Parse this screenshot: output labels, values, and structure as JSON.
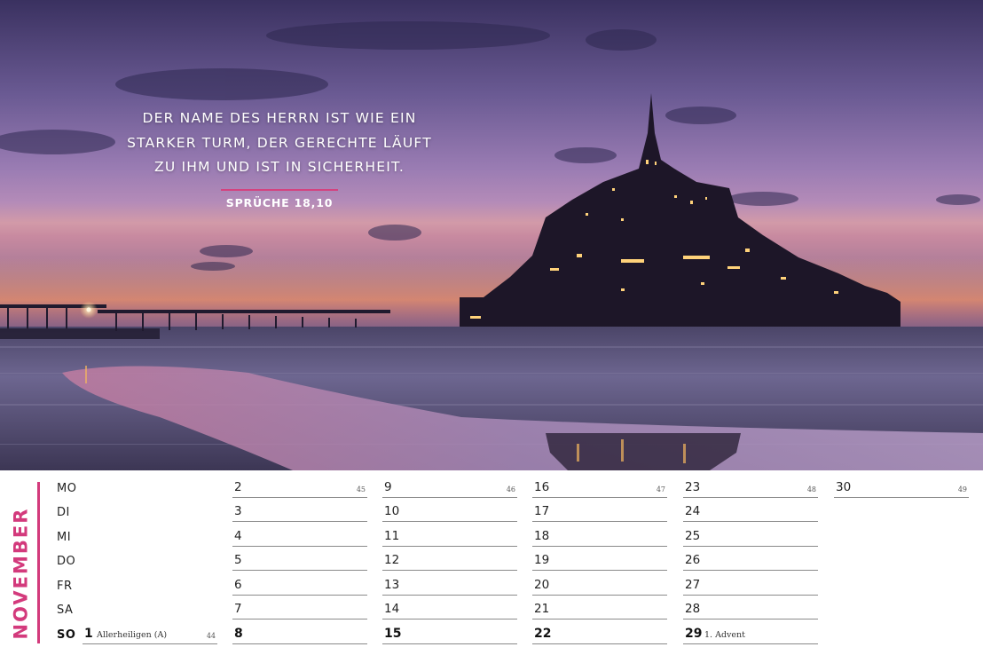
{
  "quote": {
    "lines": [
      "DER NAME DES HERRN IST WIE EIN",
      "STARKER TURM, DER GERECHTE LÄUFT",
      "ZU IHM UND IST IN SICHERHEIT."
    ],
    "source": "SPRÜCHE 18,10"
  },
  "calendar": {
    "month": "NOVEMBER",
    "days": [
      "MO",
      "DI",
      "MI",
      "DO",
      "FR",
      "SA",
      "SO"
    ],
    "cells": {
      "c1": {
        "day": "1",
        "note": "Allerheiligen (A)",
        "week": "44"
      },
      "c2": {
        "day": "2",
        "week": "45"
      },
      "c3": {
        "day": "3"
      },
      "c4": {
        "day": "4"
      },
      "c5": {
        "day": "5"
      },
      "c6": {
        "day": "6"
      },
      "c7": {
        "day": "7"
      },
      "c8": {
        "day": "8"
      },
      "c9": {
        "day": "9",
        "week": "46"
      },
      "c10": {
        "day": "10"
      },
      "c11": {
        "day": "11"
      },
      "c12": {
        "day": "12"
      },
      "c13": {
        "day": "13"
      },
      "c14": {
        "day": "14"
      },
      "c15": {
        "day": "15"
      },
      "c16": {
        "day": "16",
        "week": "47"
      },
      "c17": {
        "day": "17"
      },
      "c18": {
        "day": "18"
      },
      "c19": {
        "day": "19"
      },
      "c20": {
        "day": "20"
      },
      "c21": {
        "day": "21"
      },
      "c22": {
        "day": "22"
      },
      "c23": {
        "day": "23",
        "week": "48"
      },
      "c24": {
        "day": "24"
      },
      "c25": {
        "day": "25"
      },
      "c26": {
        "day": "26"
      },
      "c27": {
        "day": "27"
      },
      "c28": {
        "day": "28"
      },
      "c29": {
        "day": "29",
        "note": "1. Advent"
      },
      "c30": {
        "day": "30",
        "week": "49"
      }
    }
  },
  "colors": {
    "accent": "#d33a7c",
    "sky_top": "#3e3462",
    "sky_mid": "#8a6aa6",
    "horizon": "#e8956e"
  }
}
